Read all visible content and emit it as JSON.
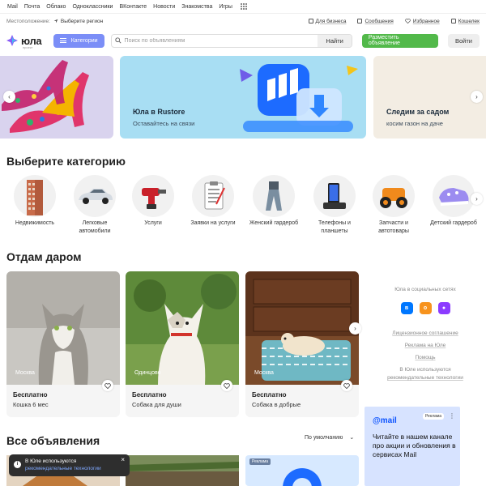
{
  "mailbar": {
    "items": [
      "Mail",
      "Почта",
      "Облако",
      "Одноклассники",
      "ВКонтакте",
      "Новости",
      "Знакомства",
      "Игры"
    ]
  },
  "location": {
    "label": "Местоположение:",
    "value": "Выберите регион"
  },
  "topright": {
    "business": "Для бизнеса",
    "messages": "Сообщения",
    "favorites": "Избранное",
    "wallet": "Кошелек"
  },
  "header": {
    "logo": "юла",
    "logo_sub": "проект",
    "categories_button": "Категории",
    "search_placeholder": "Поиск по объявлениям",
    "search_button": "Найти",
    "post_button": "Разместить объявление",
    "login_button": "Войти"
  },
  "banners": [
    {
      "title": "",
      "subtitle": ""
    },
    {
      "title": "Юла в Rustore",
      "subtitle": "Оставайтесь на связи"
    },
    {
      "title": "Следим за садом",
      "subtitle": "косим газон на даче"
    }
  ],
  "categories_section": {
    "heading": "Выберите категорию",
    "items": [
      {
        "label": "Недвижимость"
      },
      {
        "label": "Легковые автомобили"
      },
      {
        "label": "Услуги"
      },
      {
        "label": "Заявки на услуги"
      },
      {
        "label": "Женский гардероб"
      },
      {
        "label": "Телефоны и планшеты"
      },
      {
        "label": "Запчасти и автотовары"
      },
      {
        "label": "Детский гардероб"
      }
    ]
  },
  "free_section": {
    "heading": "Отдам даром",
    "cards": [
      {
        "city": "Москва",
        "price": "Бесплатно",
        "title": "Кошка 6 мес"
      },
      {
        "city": "Одинцово",
        "price": "Бесплатно",
        "title": "Собака для души"
      },
      {
        "city": "Москва",
        "price": "Бесплатно",
        "title": "Собака в добрые"
      }
    ]
  },
  "side": {
    "social_title": "Юла в социальных сетях",
    "links": [
      "Лицензионное соглашение",
      "Реклама на Юле",
      "Помощь"
    ],
    "tech_note": "В Юле используются",
    "tech_link": "рекомендательные технологии"
  },
  "all_ads": {
    "heading": "Все объявления",
    "sort": "По умолчанию",
    "ad_tag": "Реклама"
  },
  "ad_banner": {
    "brand": "@mail",
    "tag": "Реклама",
    "text": "Читайте в нашем канале про акции и обновления в сервисах Mail"
  },
  "toast": {
    "text": "В Юле используются",
    "link": "рекомендательные технологии"
  },
  "colors": {
    "accent": "#7b8ef7",
    "post": "#52b94a",
    "mail_blue": "#0d54ff"
  }
}
